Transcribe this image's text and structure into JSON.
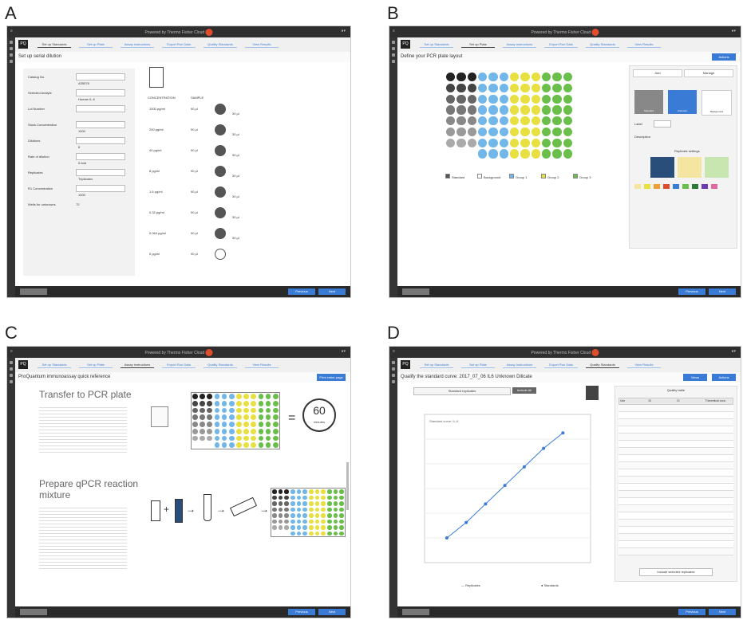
{
  "panels": [
    {
      "letter": "A",
      "title": "Set up serial dilution"
    },
    {
      "letter": "B",
      "title": "Define your PCR plate layout"
    },
    {
      "letter": "C",
      "title": "ProQuantum immunoassay quick reference"
    },
    {
      "letter": "D",
      "title": "Qualify the standard curve: 2017_07_06 IL6 Unknown Dilicate"
    }
  ],
  "app": {
    "window_title": "ProQuantum",
    "brand": "Thermo Fisher Cloud",
    "powered": "Powered by",
    "badge": "PQ"
  },
  "wizard_steps": [
    "Set up Standards",
    "Set up Plate",
    "Assay Instructions",
    "Export Run Data",
    "Quality Standards",
    "View Results"
  ],
  "buttons": {
    "cancel": "Cancel",
    "previous": "Previous",
    "next": "Next",
    "actions": "Actions",
    "print": "Print entire page",
    "views": "Views"
  },
  "panel_a": {
    "fields": [
      {
        "label": "Catalog No.",
        "value": "A35576"
      },
      {
        "label": "Selected Analyte",
        "value": "Human IL-6"
      },
      {
        "label": "Lot Number",
        "value": ""
      },
      {
        "label": "Stock Concentration",
        "value": "1000"
      },
      {
        "label": "Dilutions",
        "value": "8"
      },
      {
        "label": "Rate of dilution",
        "value": "5-fold"
      },
      {
        "label": "Replicates",
        "value": "Triplicates"
      },
      {
        "label": "R1 Concentration",
        "value": "1000"
      },
      {
        "label": "Wells for unknowns",
        "value": "72"
      }
    ],
    "dilution_header": [
      "CONCENTRATION",
      "SAMPLE"
    ],
    "dilutions": [
      {
        "conc": "1000 pg/ml",
        "vol": "90 µl"
      },
      {
        "conc": "200 pg/ml",
        "vol": "90 µl"
      },
      {
        "conc": "40 pg/ml",
        "vol": "90 µl"
      },
      {
        "conc": "8 pg/ml",
        "vol": "90 µl"
      },
      {
        "conc": "1.6 pg/ml",
        "vol": "90 µl"
      },
      {
        "conc": "0.32 pg/ml",
        "vol": "90 µl"
      },
      {
        "conc": "0.064 pg/ml",
        "vol": "90 µl"
      },
      {
        "conc": "0 pg/ml",
        "vol": "90 µl"
      }
    ],
    "transfer": "30 µl"
  },
  "panel_b": {
    "tabs": [
      "Add",
      "Manage"
    ],
    "types": [
      "Standard",
      "Unknown",
      "Background"
    ],
    "label": "Label",
    "description": "Description",
    "replicate": "Replicate settings",
    "legend": [
      "Standard",
      "Background",
      "Group 1",
      "Group 2",
      "Group 3"
    ],
    "row_letters": [
      "A",
      "B",
      "C",
      "D",
      "E",
      "F",
      "G",
      "H"
    ]
  },
  "panel_c": {
    "section1": "Transfer to PCR plate",
    "section2": "Prepare qPCR reaction mixture",
    "timer_value": "60",
    "timer_unit": "minutes"
  },
  "panel_d": {
    "chart_title": "Standard curve: IL-6",
    "side_title": "Quality table",
    "table_headers": [
      "Use",
      "ID",
      "Ct",
      "Theoretical conc."
    ],
    "legend": [
      "Replicates",
      "Standards"
    ],
    "toggle": "Standard replicates",
    "include_btn": "Include All",
    "exclude_btn": "Include selected replicates"
  },
  "chart_data": {
    "type": "scatter",
    "title": "Standard curve: IL-6",
    "x_scale": "log",
    "x": [
      0.064,
      0.32,
      1.6,
      8,
      40,
      200,
      1000
    ],
    "y": [
      22,
      24.5,
      27.5,
      30.5,
      33.5,
      36.5,
      39
    ],
    "grid": true
  },
  "colors": {
    "blue": "#3a7bd5",
    "dark": "#2f2f2f",
    "orange": "#f0a030",
    "green": "#6abf4b",
    "lightblue": "#72b7ea",
    "yellow": "#e8e040"
  }
}
